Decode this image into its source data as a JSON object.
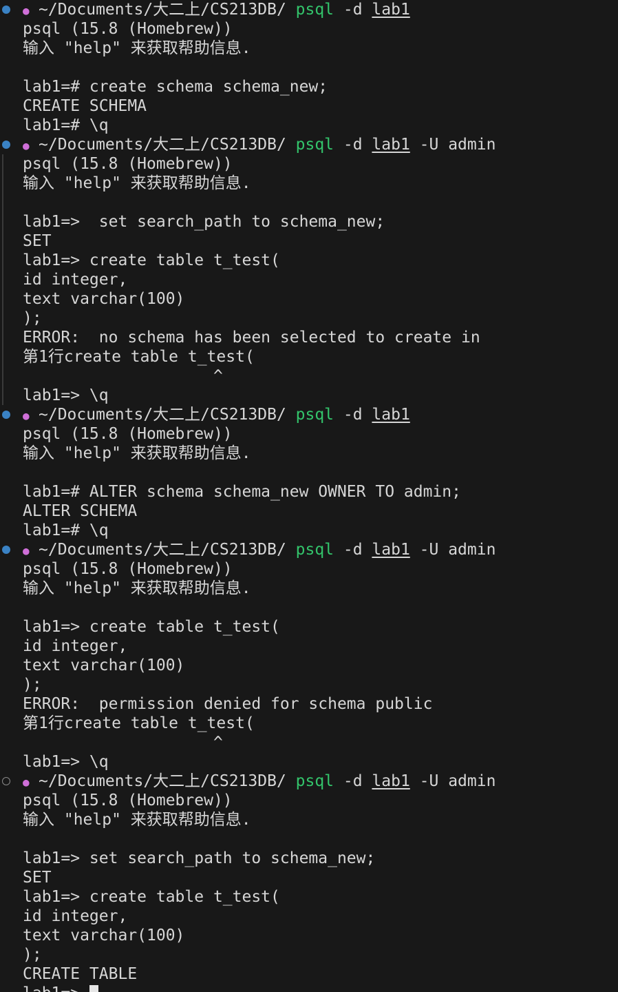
{
  "prompt": {
    "apple": "●",
    "path": "~/Documents/大二上/CS213DB/",
    "cmd": "psql",
    "db_flag": "-d",
    "db": "lab1",
    "user_flag": "-U",
    "user": "admin"
  },
  "psql": {
    "version": "psql (15.8 (Homebrew))",
    "help": "输入 \"help\" 来获取帮助信息."
  },
  "sessions": [
    {
      "user": false,
      "status": "filled",
      "lines": [
        "lab1=# create schema schema_new;",
        "CREATE SCHEMA",
        "lab1=# \\q"
      ]
    },
    {
      "user": true,
      "status": "filled",
      "lines": [
        "lab1=>  set search_path to schema_new;",
        "SET",
        "lab1=> create table t_test(",
        "id integer,",
        "text varchar(100)",
        ");",
        "ERROR:  no schema has been selected to create in",
        "第1行create table t_test(",
        "                    ^",
        "lab1=> \\q"
      ]
    },
    {
      "user": false,
      "status": "filled",
      "lines": [
        "lab1=# ALTER schema schema_new OWNER TO admin;",
        "ALTER SCHEMA",
        "lab1=# \\q"
      ]
    },
    {
      "user": true,
      "status": "filled",
      "lines": [
        "lab1=> create table t_test(",
        "id integer,",
        "text varchar(100)",
        ");",
        "ERROR:  permission denied for schema public",
        "第1行create table t_test(",
        "                    ^",
        "lab1=> \\q"
      ]
    },
    {
      "user": true,
      "status": "hollow",
      "lines": [
        "lab1=> set search_path to schema_new;",
        "SET",
        "lab1=> create table t_test(",
        "id integer,",
        "text varchar(100)",
        ");",
        "CREATE TABLE"
      ],
      "final_prompt": "lab1=> "
    }
  ]
}
